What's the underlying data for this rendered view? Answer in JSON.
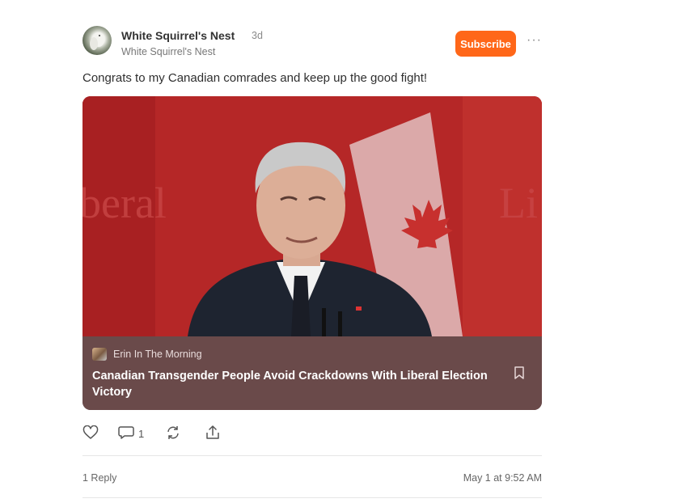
{
  "post": {
    "author": "White Squirrel's Nest",
    "time": "3d",
    "publication": "White Squirrel's Nest",
    "subscribe_label": "Subscribe",
    "more_label": "···",
    "text": "Congrats to my Canadian comrades and keep up the good fight!"
  },
  "embed": {
    "publication": "Erin In The Morning",
    "title": "Canadian Transgender People Avoid Crackdowns With Liberal Election Victory",
    "background_text_left": "beral",
    "background_text_right": "Li"
  },
  "actions": {
    "comment_count": "1"
  },
  "footer": {
    "replies": "1 Reply",
    "date": "May 1 at 9:52 AM"
  },
  "colors": {
    "accent": "#ff6719",
    "embed_meta_bg": "#6a4a4a"
  },
  "icons": [
    "heart-icon",
    "comment-icon",
    "restack-icon",
    "share-icon",
    "bookmark-icon",
    "more-icon"
  ]
}
